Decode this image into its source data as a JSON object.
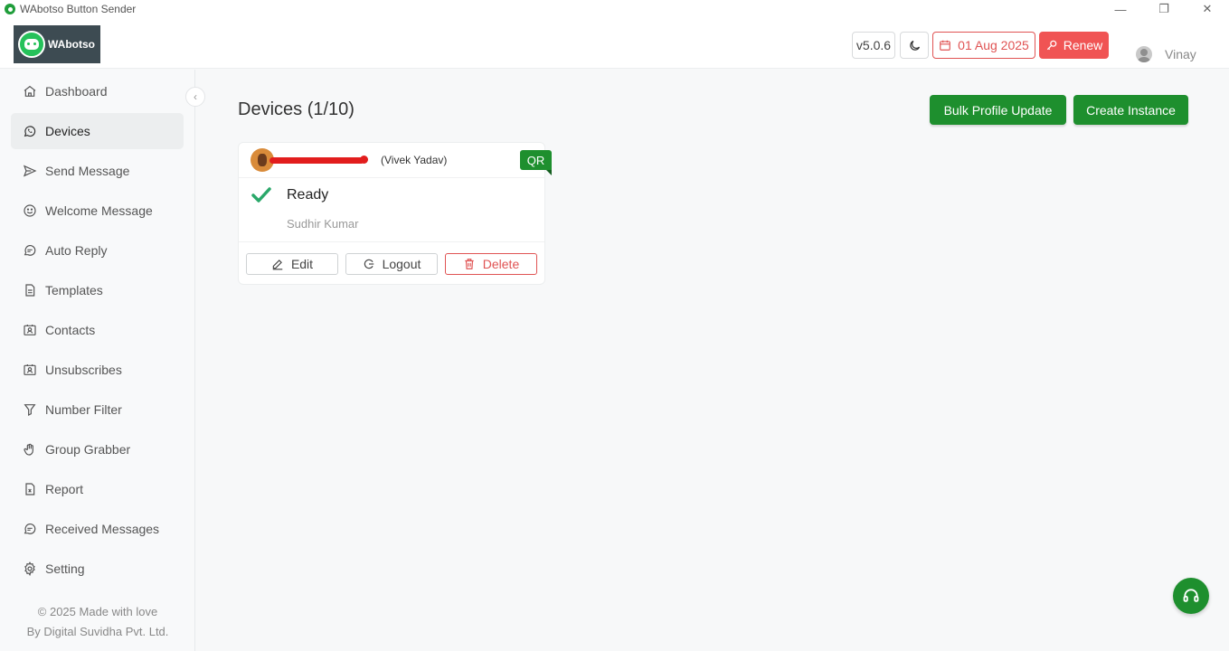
{
  "window": {
    "title": "WAbotso Button Sender",
    "controls": {
      "minimize": "—",
      "restore": "❐",
      "close": "✕"
    }
  },
  "header": {
    "logo_text": "WAbotso",
    "version": "v5.0.6",
    "expiry_date": "01 Aug 2025",
    "renew_label": "Renew",
    "user_name": "Vinay"
  },
  "sidebar": {
    "items": [
      {
        "label": "Dashboard",
        "icon": "home-icon"
      },
      {
        "label": "Devices",
        "icon": "whatsapp-icon",
        "active": true
      },
      {
        "label": "Send Message",
        "icon": "send-icon"
      },
      {
        "label": "Welcome Message",
        "icon": "smile-icon"
      },
      {
        "label": "Auto Reply",
        "icon": "chat-icon"
      },
      {
        "label": "Templates",
        "icon": "document-icon"
      },
      {
        "label": "Contacts",
        "icon": "contact-card-icon"
      },
      {
        "label": "Unsubscribes",
        "icon": "contact-card-icon"
      },
      {
        "label": "Number Filter",
        "icon": "filter-icon"
      },
      {
        "label": "Group Grabber",
        "icon": "grab-icon"
      },
      {
        "label": "Report",
        "icon": "excel-icon"
      },
      {
        "label": "Received Messages",
        "icon": "chat-icon"
      },
      {
        "label": "Setting",
        "icon": "gear-icon"
      }
    ],
    "footer_line1": "© 2025 Made with love",
    "footer_line2": "By Digital Suvidha Pvt. Ltd."
  },
  "main": {
    "title": "Devices (1/10)",
    "bulk_profile_update_label": "Bulk Profile Update",
    "create_instance_label": "Create Instance",
    "device": {
      "name": "(Vivek Yadav)",
      "badge": "QR",
      "status": "Ready",
      "owner": "Sudhir Kumar",
      "edit_label": "Edit",
      "logout_label": "Logout",
      "delete_label": "Delete"
    }
  },
  "colors": {
    "brand_green": "#1e8f2e",
    "danger_red": "#e05353",
    "renew_red": "#f05454",
    "check_green": "#2aa86a"
  }
}
